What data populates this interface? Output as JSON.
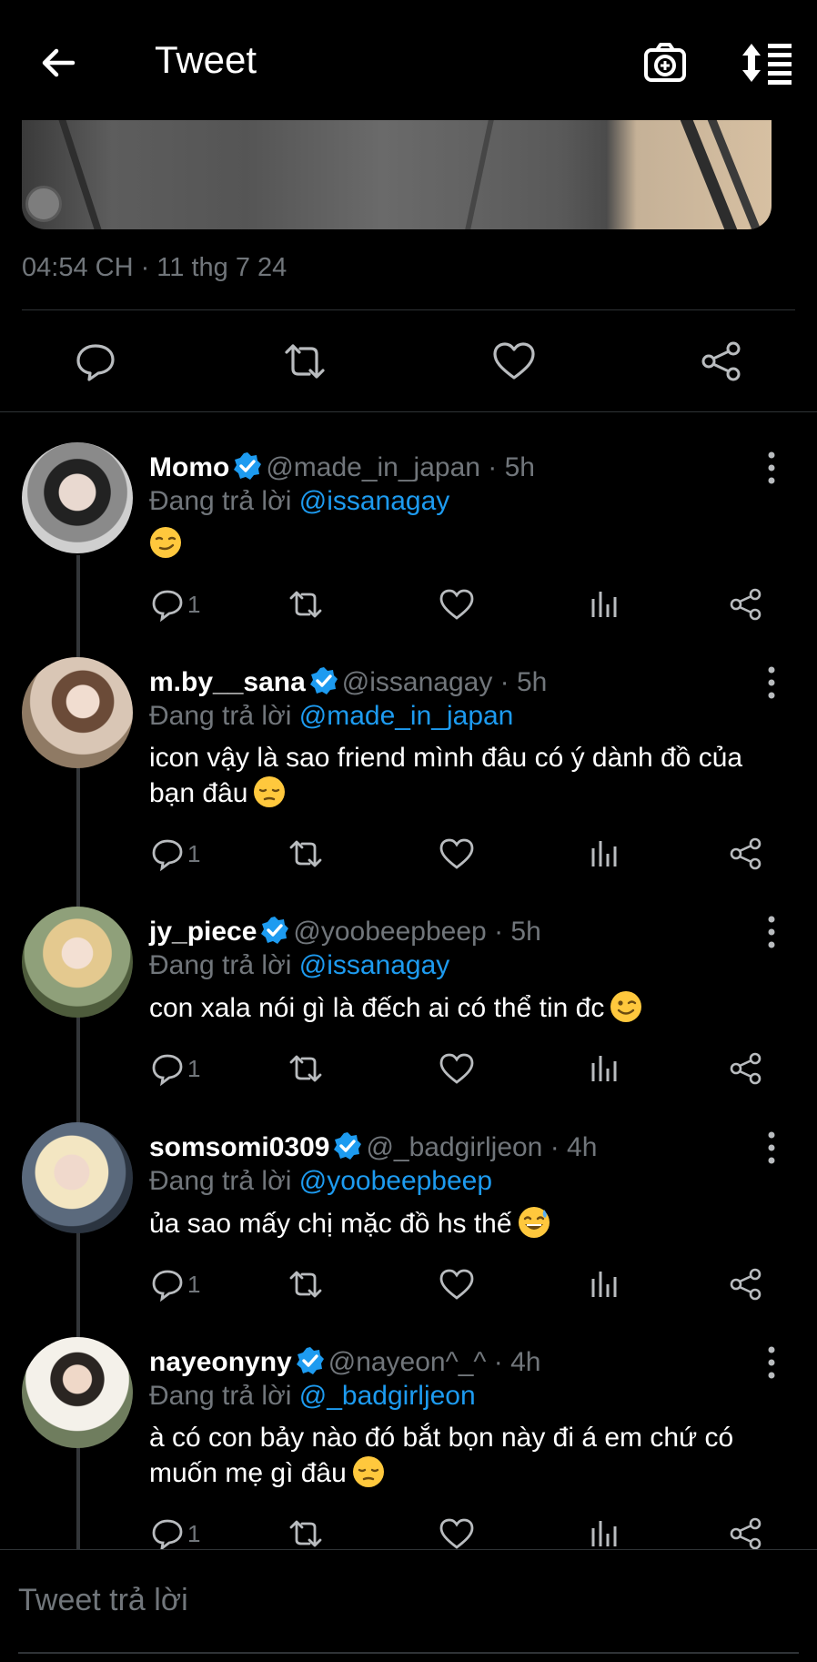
{
  "header": {
    "title": "Tweet",
    "back_icon": "arrow-left-icon",
    "camera_icon": "camera-plus-icon",
    "sort_icon": "sort-icon"
  },
  "tweet": {
    "timestamp": "04:54 CH · 11 thg 7 24"
  },
  "replies": [
    {
      "name": "Momo",
      "handle": "@made_in_japan",
      "time": "· 5h",
      "replying_prefix": "Đang trả lời",
      "replying_to": "@issanagay",
      "text": "",
      "emoji": "smirk",
      "reply_count": "1"
    },
    {
      "name": "m.by__sana",
      "handle": "@issanagay",
      "time": "· 5h",
      "replying_prefix": "Đang trả lời",
      "replying_to": "@made_in_japan",
      "text": "icon vậy là sao friend mình đâu có ý dành đồ của bạn đâu",
      "emoji": "pensive",
      "reply_count": "1"
    },
    {
      "name": "jy_piece",
      "handle": "@yoobeepbeep",
      "time": "· 5h",
      "replying_prefix": "Đang trả lời",
      "replying_to": "@issanagay",
      "text": "con xala nói gì là đếch ai có thể tin đc",
      "emoji": "wink",
      "reply_count": "1"
    },
    {
      "name": "somsomi0309",
      "handle": "@_badgirljeon",
      "time": "· 4h",
      "replying_prefix": "Đang trả lời",
      "replying_to": "@yoobeepbeep",
      "text": "ủa sao mấy chị mặc đồ hs thế",
      "emoji": "sweat-smile",
      "reply_count": "1"
    },
    {
      "name": "nayeonyny",
      "handle": "@nayeon^_^",
      "time": "· 4h",
      "replying_prefix": "Đang trả lời",
      "replying_to": "@_badgirljeon",
      "text": "à có con bảy nào đó bắt bọn này đi á em chứ có muốn mẹ gì đâu",
      "emoji": "pensive",
      "reply_count": "1"
    }
  ],
  "composer": {
    "placeholder": "Tweet trả lời"
  },
  "colors": {
    "background": "#000000",
    "accent": "#1d9bf0",
    "muted": "#71767b",
    "divider": "#2f3336"
  }
}
